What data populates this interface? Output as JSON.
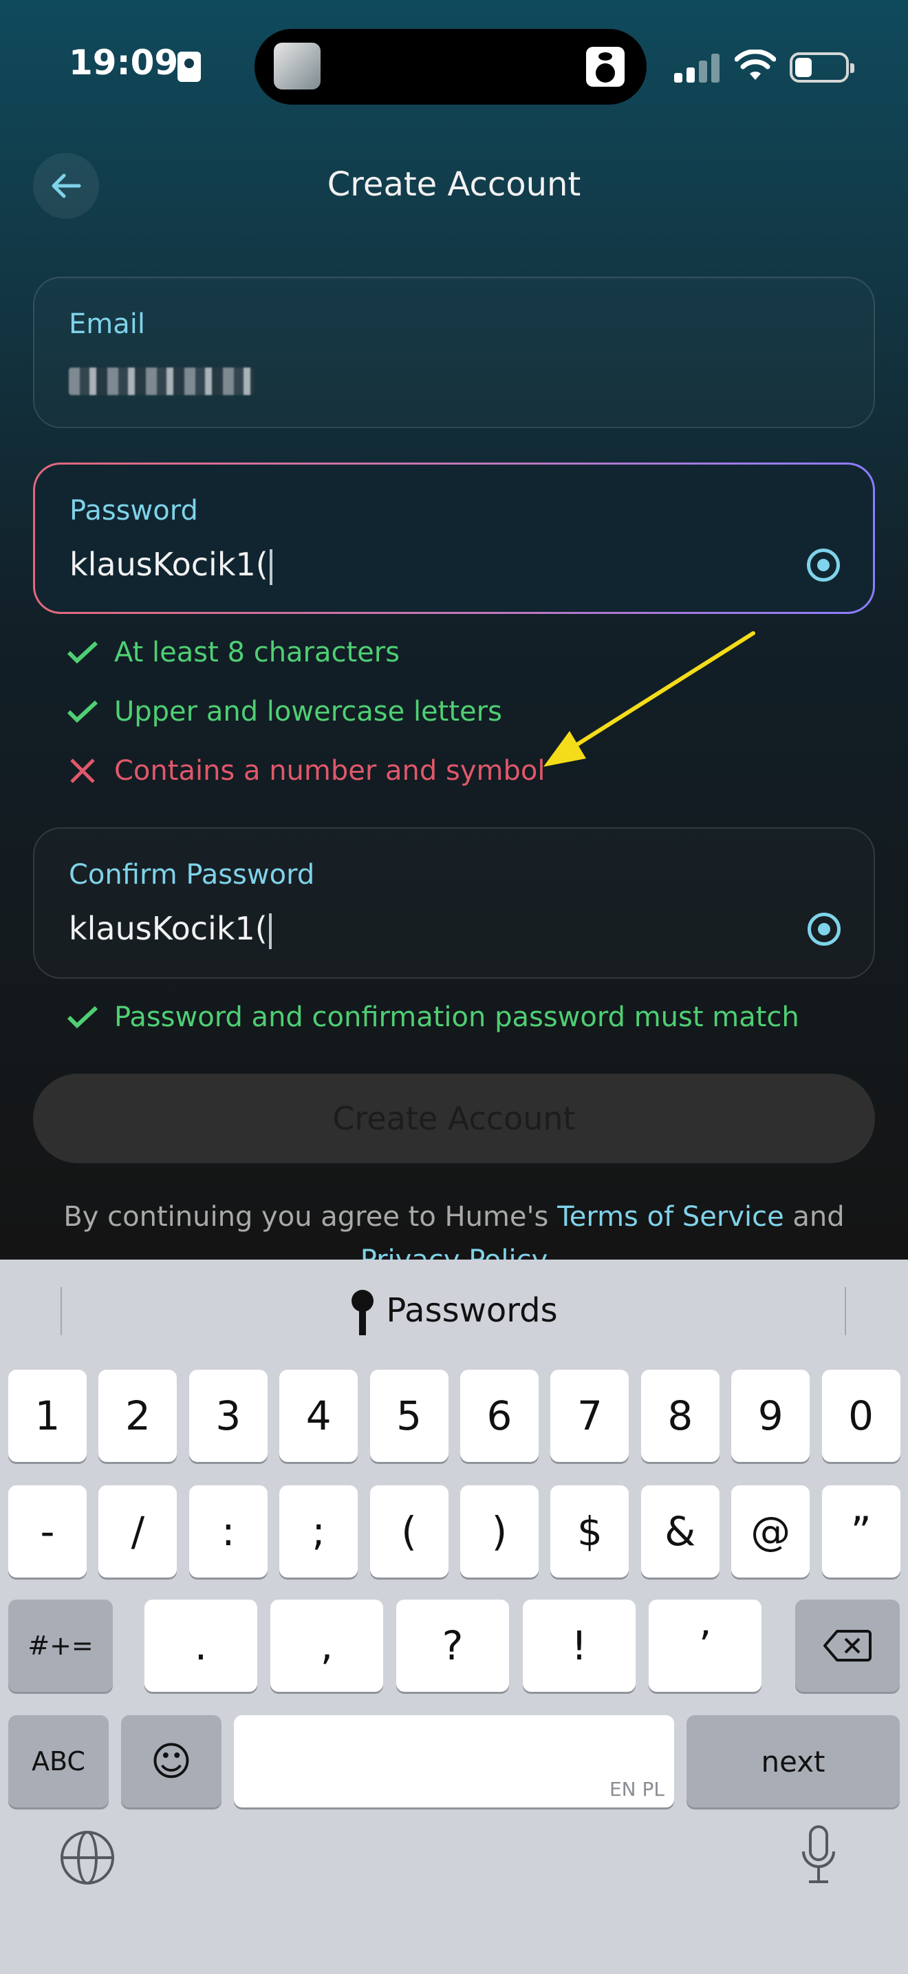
{
  "status_bar": {
    "time": "19:09"
  },
  "header": {
    "title": "Create Account"
  },
  "email": {
    "label": "Email"
  },
  "password": {
    "label": "Password",
    "value": "klausKocik1("
  },
  "rules": [
    {
      "text": "At least 8 characters",
      "state": "ok"
    },
    {
      "text": "Upper and lowercase letters",
      "state": "ok"
    },
    {
      "text": "Contains a number and symbol",
      "state": "fail"
    }
  ],
  "confirm": {
    "label": "Confirm Password",
    "value": "klausKocik1("
  },
  "match_rule": {
    "text": "Password and confirmation password must match",
    "state": "ok"
  },
  "create_button": "Create Account",
  "terms": {
    "prefix": "By continuing you agree to Hume's ",
    "tos": "Terms of Service",
    "and": " and",
    "privacy": "Privacy Policy"
  },
  "keyboard": {
    "bar_label": "Passwords",
    "row1": [
      "1",
      "2",
      "3",
      "4",
      "5",
      "6",
      "7",
      "8",
      "9",
      "0"
    ],
    "row2": [
      "-",
      "/",
      ":",
      ";",
      "(",
      ")",
      "$",
      "&",
      "@",
      "”"
    ],
    "row3": [
      "#+=",
      ".",
      ",",
      "?",
      "!",
      "’"
    ],
    "abc": "ABC",
    "emoji": "☺",
    "space_tag": "EN PL",
    "next": "next"
  },
  "colors": {
    "accent": "#7fd3ea",
    "ok": "#4fcf74",
    "error": "#e0586a",
    "annotation": "#f4dc1a"
  }
}
